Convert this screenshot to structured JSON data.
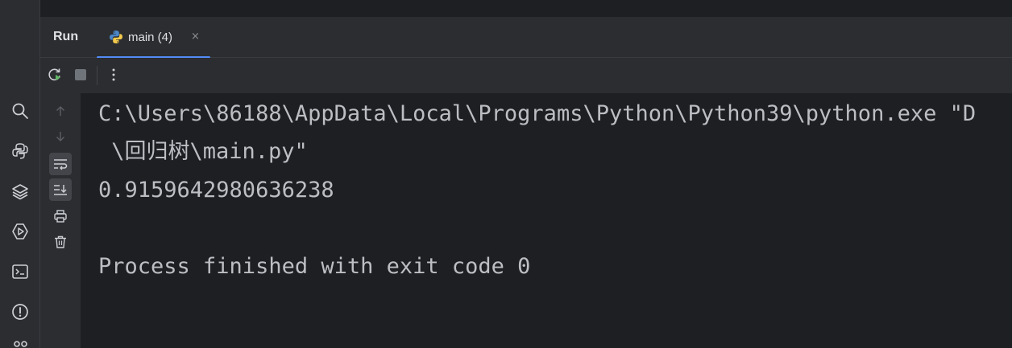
{
  "tool_window": {
    "title": "Run",
    "tab": {
      "label": "main (4)",
      "close": "×",
      "icon": "python-icon"
    }
  },
  "left_strip_icons": [
    "search-icon",
    "python-packages-icon",
    "layers-icon",
    "services-icon",
    "terminal-icon",
    "problems-icon",
    "git-icon"
  ],
  "toolbar": {
    "buttons": [
      "rerun-icon",
      "stop-icon",
      "more-options-icon"
    ]
  },
  "gutter_icons": [
    "up-arrow-icon",
    "down-arrow-icon",
    "soft-wrap-icon",
    "scroll-to-end-icon",
    "print-icon",
    "trash-icon"
  ],
  "console": {
    "lines": [
      "C:\\Users\\86188\\AppData\\Local\\Programs\\Python\\Python39\\python.exe \"D",
      " \\回归树\\main.py\"",
      "0.9159642980636238",
      "",
      "Process finished with exit code 0"
    ]
  },
  "colors": {
    "background": "#1e1f22",
    "panel": "#2b2d30",
    "text": "#bcbec4",
    "accent": "#548af7"
  }
}
